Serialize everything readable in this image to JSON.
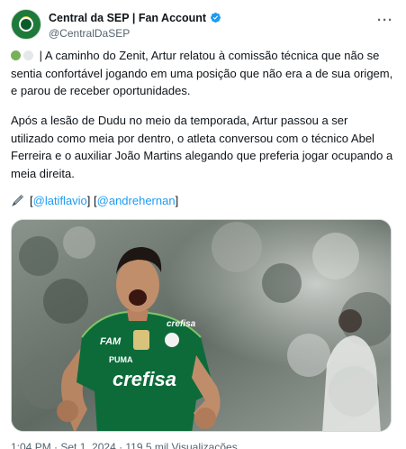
{
  "account": {
    "display_name": "Central da SEP | Fan Account",
    "handle": "@CentralDaSEP",
    "verified_color": "#1d9bf0"
  },
  "menu": {
    "more_label": "···"
  },
  "post": {
    "paragraph1": "| A caminho do Zenit, Artur relatou à comissão técnica que não se sentia confortável jogando em uma posição que não era a de sua origem, e parou de receber oportunidades.",
    "paragraph2": "Após a lesão de Dudu no meio da temporada, Artur passou a ser utilizado como meia por dentro, o atleta conversou com o técnico Abel Ferreira e o auxiliar João Martins alegando que preferia jogar ocupando a meia direita.",
    "credits": {
      "open1": "[",
      "mention1": "@latiflavio",
      "sep": "] [",
      "mention2": "@andrehernan",
      "close": "]"
    },
    "status_dots": [
      "green",
      "white"
    ]
  },
  "photo": {
    "jersey_sponsor": "crefisa",
    "jersey_brand": "PUMA",
    "sleeve_text": "FAM",
    "chest_text": "crefisa",
    "side_text": "crefisa"
  },
  "footer": {
    "text_partial": "1:04 PM · Set 1, 2024 · 119.5 mil Visualizações"
  },
  "colors": {
    "accent": "#1d9bf0",
    "jersey_green": "#0d6b3a",
    "text_secondary": "#536471"
  }
}
